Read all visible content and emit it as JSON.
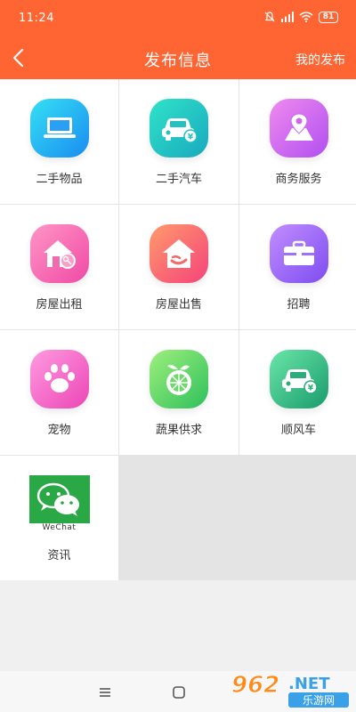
{
  "status_bar": {
    "time": "11:24",
    "battery": "81"
  },
  "header": {
    "title": "发布信息",
    "right_label": "我的发布"
  },
  "grid": {
    "items": [
      {
        "label": "二手物品",
        "icon": "laptop-icon"
      },
      {
        "label": "二手汽车",
        "icon": "car-yen-icon"
      },
      {
        "label": "商务服务",
        "icon": "map-pin-icon"
      },
      {
        "label": "房屋出租",
        "icon": "house-key-icon"
      },
      {
        "label": "房屋出售",
        "icon": "house-sale-icon"
      },
      {
        "label": "招聘",
        "icon": "briefcase-icon"
      },
      {
        "label": "宠物",
        "icon": "paw-icon"
      },
      {
        "label": "蔬果供求",
        "icon": "fruit-icon"
      },
      {
        "label": "顺风车",
        "icon": "car-yen-icon"
      },
      {
        "label": "资讯",
        "icon": "wechat-icon",
        "icon_caption": "WeChat"
      }
    ]
  },
  "watermark": {
    "number": "962",
    "suffix": ".NET",
    "site": "乐游网"
  },
  "colors": {
    "header_bg": "#fe6532",
    "wechat_green": "#2aa845"
  }
}
